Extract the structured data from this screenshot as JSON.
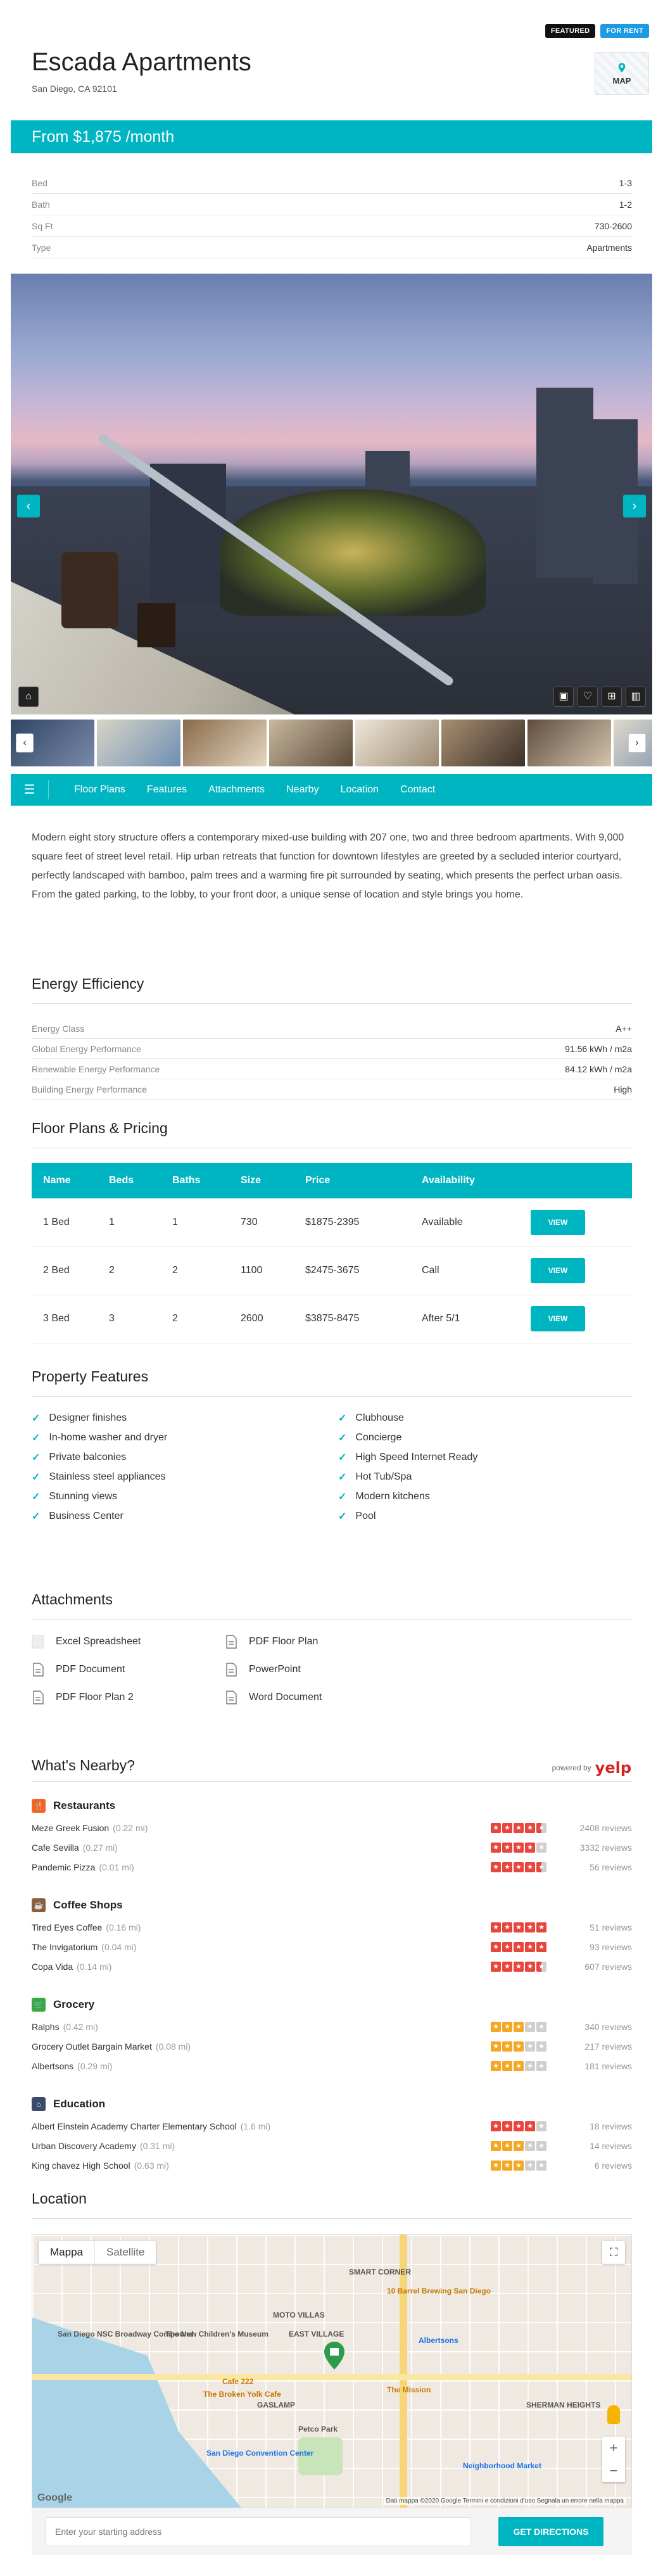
{
  "header": {
    "badge_featured": "FEATURED",
    "badge_for_rent": "FOR RENT",
    "title": "Escada Apartments",
    "address": "San Diego, CA 92101",
    "map_label": "MAP",
    "price": "From $1,875 /month"
  },
  "specs": [
    {
      "label": "Bed",
      "value": "1-3"
    },
    {
      "label": "Bath",
      "value": "1-2"
    },
    {
      "label": "Sq Ft",
      "value": "730-2600"
    },
    {
      "label": "Type",
      "value": "Apartments"
    }
  ],
  "gallery": {
    "prev": "‹",
    "next": "›",
    "thumb_prev": "‹",
    "thumb_next": "›",
    "icons": [
      "home-icon",
      "image-icon",
      "heart-icon",
      "plus-icon",
      "chart-icon"
    ]
  },
  "nav": {
    "menu_icon": "menu-icon",
    "items": [
      "Floor Plans",
      "Features",
      "Attachments",
      "Nearby",
      "Location",
      "Contact"
    ]
  },
  "description": "Modern eight story structure offers a contemporary mixed-use building with 207 one, two and three bedroom apartments. With 9,000 square feet of street level retail. Hip urban retreats that function for downtown lifestyles are greeted by a secluded interior courtyard, perfectly landscaped with bamboo, palm trees and a warming fire pit surrounded by seating, which presents the perfect urban oasis. From the gated parking, to the lobby, to your front door, a unique sense of location and style brings you home.",
  "energy": {
    "title": "Energy Efficiency",
    "rows": [
      {
        "label": "Energy Class",
        "value": "A++"
      },
      {
        "label": "Global Energy Performance",
        "value": "91.56 kWh / m2a"
      },
      {
        "label": "Renewable Energy Performance",
        "value": "84.12 kWh / m2a"
      },
      {
        "label": "Building Energy Performance",
        "value": "High"
      }
    ]
  },
  "floor_plans": {
    "title": "Floor Plans & Pricing",
    "headers": [
      "Name",
      "Beds",
      "Baths",
      "Size",
      "Price",
      "Availability",
      ""
    ],
    "view_label": "VIEW",
    "rows": [
      {
        "name": "1 Bed",
        "beds": "1",
        "baths": "1",
        "size": "730",
        "price": "$1875-2395",
        "availability": "Available"
      },
      {
        "name": "2 Bed",
        "beds": "2",
        "baths": "2",
        "size": "1100",
        "price": "$2475-3675",
        "availability": "Call"
      },
      {
        "name": "3 Bed",
        "beds": "3",
        "baths": "2",
        "size": "2600",
        "price": "$3875-8475",
        "availability": "After 5/1"
      }
    ]
  },
  "features": {
    "title": "Property Features",
    "items": [
      "Designer finishes",
      "Clubhouse",
      "In-home washer and dryer",
      "Concierge",
      "Private balconies",
      "High Speed Internet Ready",
      "Stainless steel appliances",
      "Hot Tub/Spa",
      "Stunning views",
      "Modern kitchens",
      "Business Center",
      "Pool"
    ]
  },
  "attachments": {
    "title": "Attachments",
    "items": [
      "Excel Spreadsheet",
      "PDF Floor Plan",
      "PDF Document",
      "PowerPoint",
      "PDF Floor Plan 2",
      "Word Document"
    ]
  },
  "nearby": {
    "title": "What's Nearby?",
    "powered_by": "powered by",
    "yelp": "yelp",
    "categories": [
      {
        "name": "Restaurants",
        "icon": "restaurant-icon",
        "color": "#f26522",
        "places": [
          {
            "name": "Meze Greek Fusion",
            "dist": "(0.22 mi)",
            "rating": 4.5,
            "reviews": "2408 reviews"
          },
          {
            "name": "Cafe Sevilla",
            "dist": "(0.27 mi)",
            "rating": 4,
            "reviews": "3332 reviews"
          },
          {
            "name": "Pandemic Pizza",
            "dist": "(0.01 mi)",
            "rating": 4.5,
            "reviews": "56 reviews"
          }
        ]
      },
      {
        "name": "Coffee Shops",
        "icon": "coffee-icon",
        "color": "#8b5e3c",
        "places": [
          {
            "name": "Tired Eyes Coffee",
            "dist": "(0.16 mi)",
            "rating": 5,
            "reviews": "51 reviews"
          },
          {
            "name": "The Invigatorium",
            "dist": "(0.04 mi)",
            "rating": 5,
            "reviews": "93 reviews"
          },
          {
            "name": "Copa Vida",
            "dist": "(0.14 mi)",
            "rating": 4.5,
            "reviews": "607 reviews"
          }
        ]
      },
      {
        "name": "Grocery",
        "icon": "grocery-icon",
        "color": "#39a845",
        "places": [
          {
            "name": "Ralphs",
            "dist": "(0.42 mi)",
            "rating": 3,
            "reviews": "340 reviews"
          },
          {
            "name": "Grocery Outlet Bargain Market",
            "dist": "(0.08 mi)",
            "rating": 3,
            "reviews": "217 reviews"
          },
          {
            "name": "Albertsons",
            "dist": "(0.29 mi)",
            "rating": 3,
            "reviews": "181 reviews"
          }
        ]
      },
      {
        "name": "Education",
        "icon": "education-icon",
        "color": "#3b4a6b",
        "places": [
          {
            "name": "Albert Einstein Academy Charter Elementary School",
            "dist": "(1.6 mi)",
            "rating": 4,
            "reviews": "18 reviews"
          },
          {
            "name": "Urban Discovery Academy",
            "dist": "(0.31 mi)",
            "rating": 3,
            "reviews": "14 reviews"
          },
          {
            "name": "King chavez High School",
            "dist": "(0.63 mi)",
            "rating": 3,
            "reviews": "6 reviews"
          }
        ]
      }
    ]
  },
  "location": {
    "title": "Location",
    "map_tab": "Mappa",
    "satellite_tab": "Satellite",
    "google": "Google",
    "credits": "Dati mappa ©2020 Google   Termini e condizioni d'uso   Segnala un errore nella mappa",
    "labels": [
      "SMART CORNER",
      "EAST VILLAGE",
      "Albertsons",
      "The Mission",
      "Petco Park",
      "GASLAMP",
      "San Diego Convention Center",
      "Neighborhood Market",
      "SHERMAN HEIGHTS",
      "The Broken Yolk Cafe",
      "Cafe 222",
      "10 Barrel Brewing San Diego",
      "San Diego NSC Broadway Compound",
      "The New Children's Museum",
      "MOTO VILLAS"
    ],
    "directions_placeholder": "Enter your starting address",
    "directions_button": "GET DIRECTIONS"
  },
  "colors": {
    "accent": "#00b5c2",
    "star_red": "#e8453c",
    "star_orange": "#f5a623",
    "star_empty": "#cfcfcf"
  }
}
